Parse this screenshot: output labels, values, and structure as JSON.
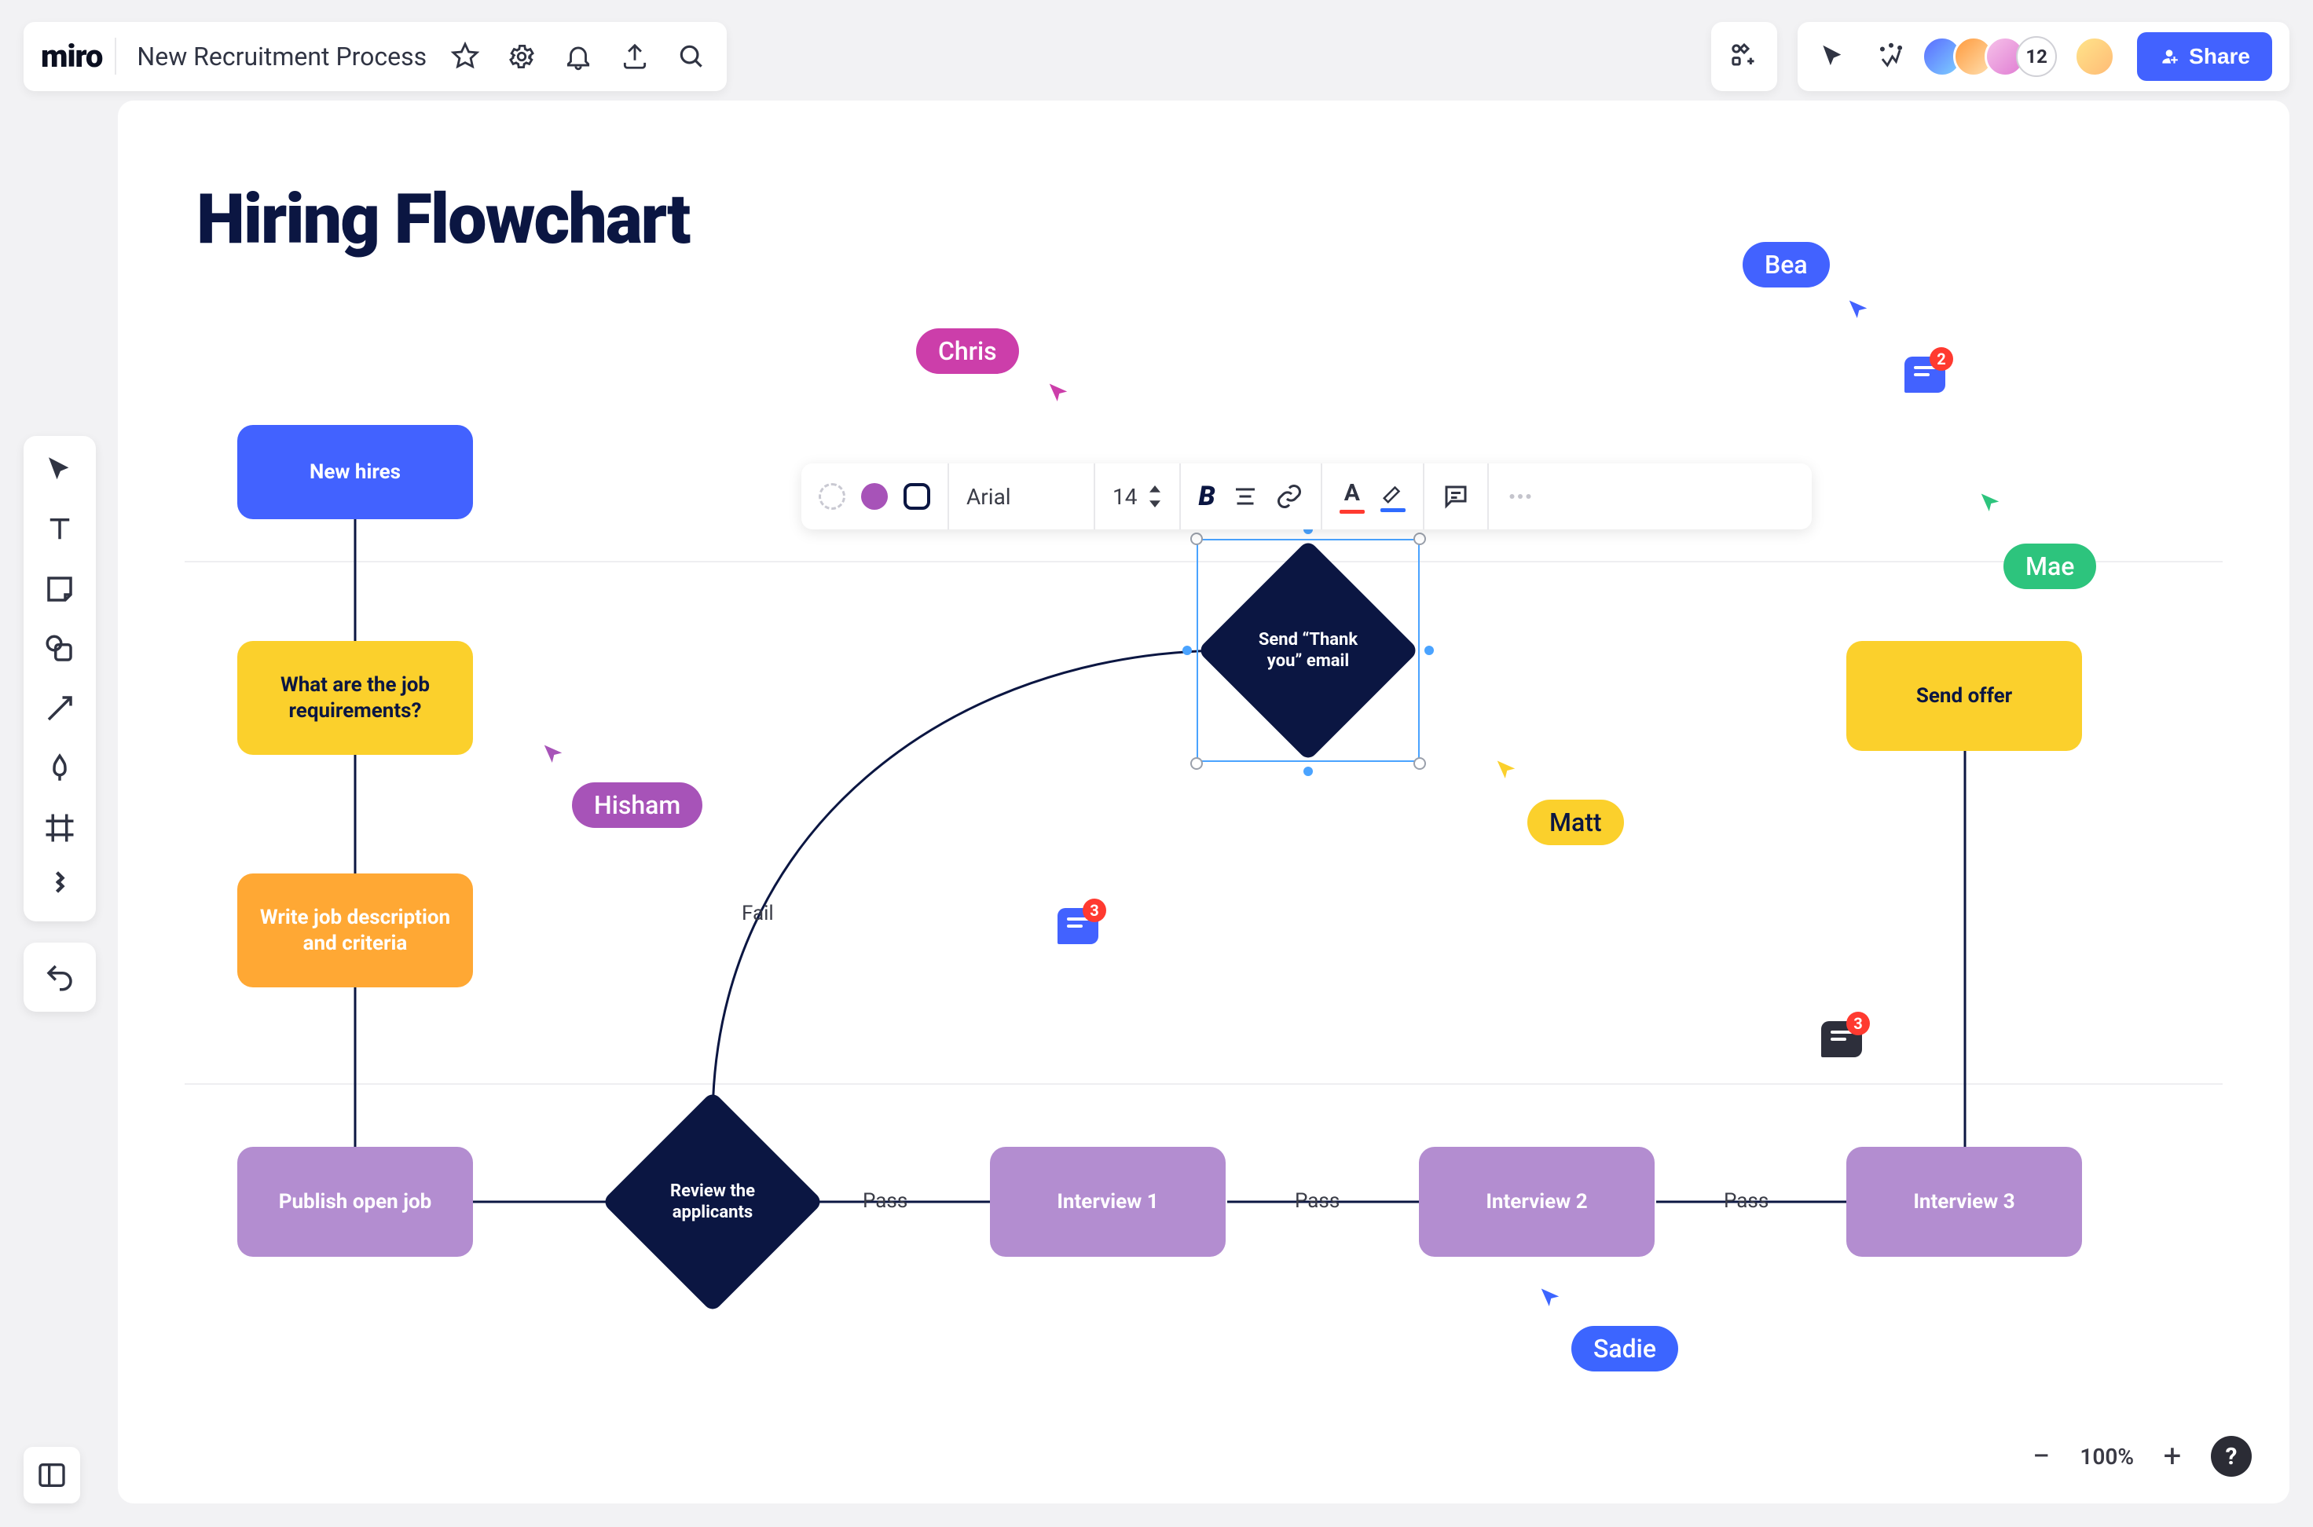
{
  "header": {
    "logo": "miro",
    "board_title": "New Recruitment Process",
    "avatar_overflow": "12",
    "share_label": "Share"
  },
  "canvas": {
    "title": "Hiring Flowchart"
  },
  "nodes": {
    "new_hires": "New hires",
    "requirements": "What are the job requirements?",
    "write_desc": "Write job description and criteria",
    "publish": "Publish open job",
    "review": "Review the applicants",
    "thank_you": "Send “Thank you” email",
    "interview1": "Interview 1",
    "interview2": "Interview 2",
    "interview3": "Interview 3",
    "send_offer": "Send offer"
  },
  "edges": {
    "fail": "Fail",
    "pass": "Pass"
  },
  "ctx_toolbar": {
    "font_name": "Arial",
    "font_size": "14"
  },
  "cursors": {
    "chris": "Chris",
    "hisham": "Hisham",
    "matt": "Matt",
    "bea": "Bea",
    "mae": "Mae",
    "sadie": "Sadie"
  },
  "comments": {
    "c1_count": "3",
    "c2_count": "2",
    "c3_count": "3"
  },
  "zoom": {
    "value": "100%"
  },
  "help": "?"
}
